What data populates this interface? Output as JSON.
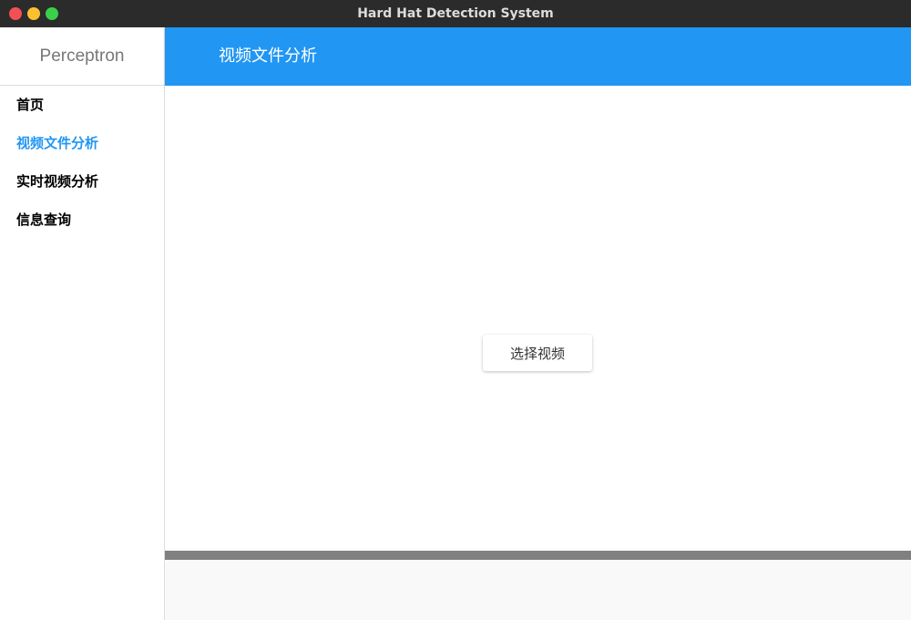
{
  "window": {
    "title": "Hard Hat Detection System"
  },
  "sidebar": {
    "brand": "Perceptron",
    "items": [
      {
        "label": "首页"
      },
      {
        "label": "视频文件分析",
        "active": true
      },
      {
        "label": "实时视频分析"
      },
      {
        "label": "信息查询"
      }
    ]
  },
  "header": {
    "title": "视频文件分析"
  },
  "main": {
    "select_video_label": "选择视频"
  },
  "colors": {
    "accent": "#2196f3",
    "titlebar": "#2b2b2b"
  }
}
